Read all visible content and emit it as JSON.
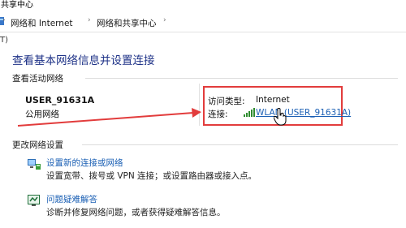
{
  "window": {
    "title": "共享中心"
  },
  "breadcrumb": {
    "items": [
      "网络和 Internet",
      "网络和共享中心"
    ],
    "separator": "›"
  },
  "menu_fragment": "T)",
  "main": {
    "heading": "查看基本网络信息并设置连接",
    "active_networks_label": "查看活动网络",
    "network": {
      "name": "USER_91631A",
      "type": "公用网络",
      "access_type_label": "访问类型:",
      "access_type_value": "Internet",
      "connections_label": "连接:",
      "connection_link": "WLAN (USER_91631A)"
    },
    "change_settings_label": "更改网络设置",
    "tasks": [
      {
        "link": "设置新的连接或网络",
        "desc": "设置宽带、拨号或 VPN 连接；或设置路由器或接入点。",
        "icon": "network-setup-icon"
      },
      {
        "link": "问题疑难解答",
        "desc": "诊断并修复网络问题，或者获得疑难解答信息。",
        "icon": "troubleshoot-icon"
      }
    ]
  },
  "colors": {
    "heading": "#1e3287",
    "link": "#1a5fb4",
    "annotation": "#e23c3c"
  }
}
